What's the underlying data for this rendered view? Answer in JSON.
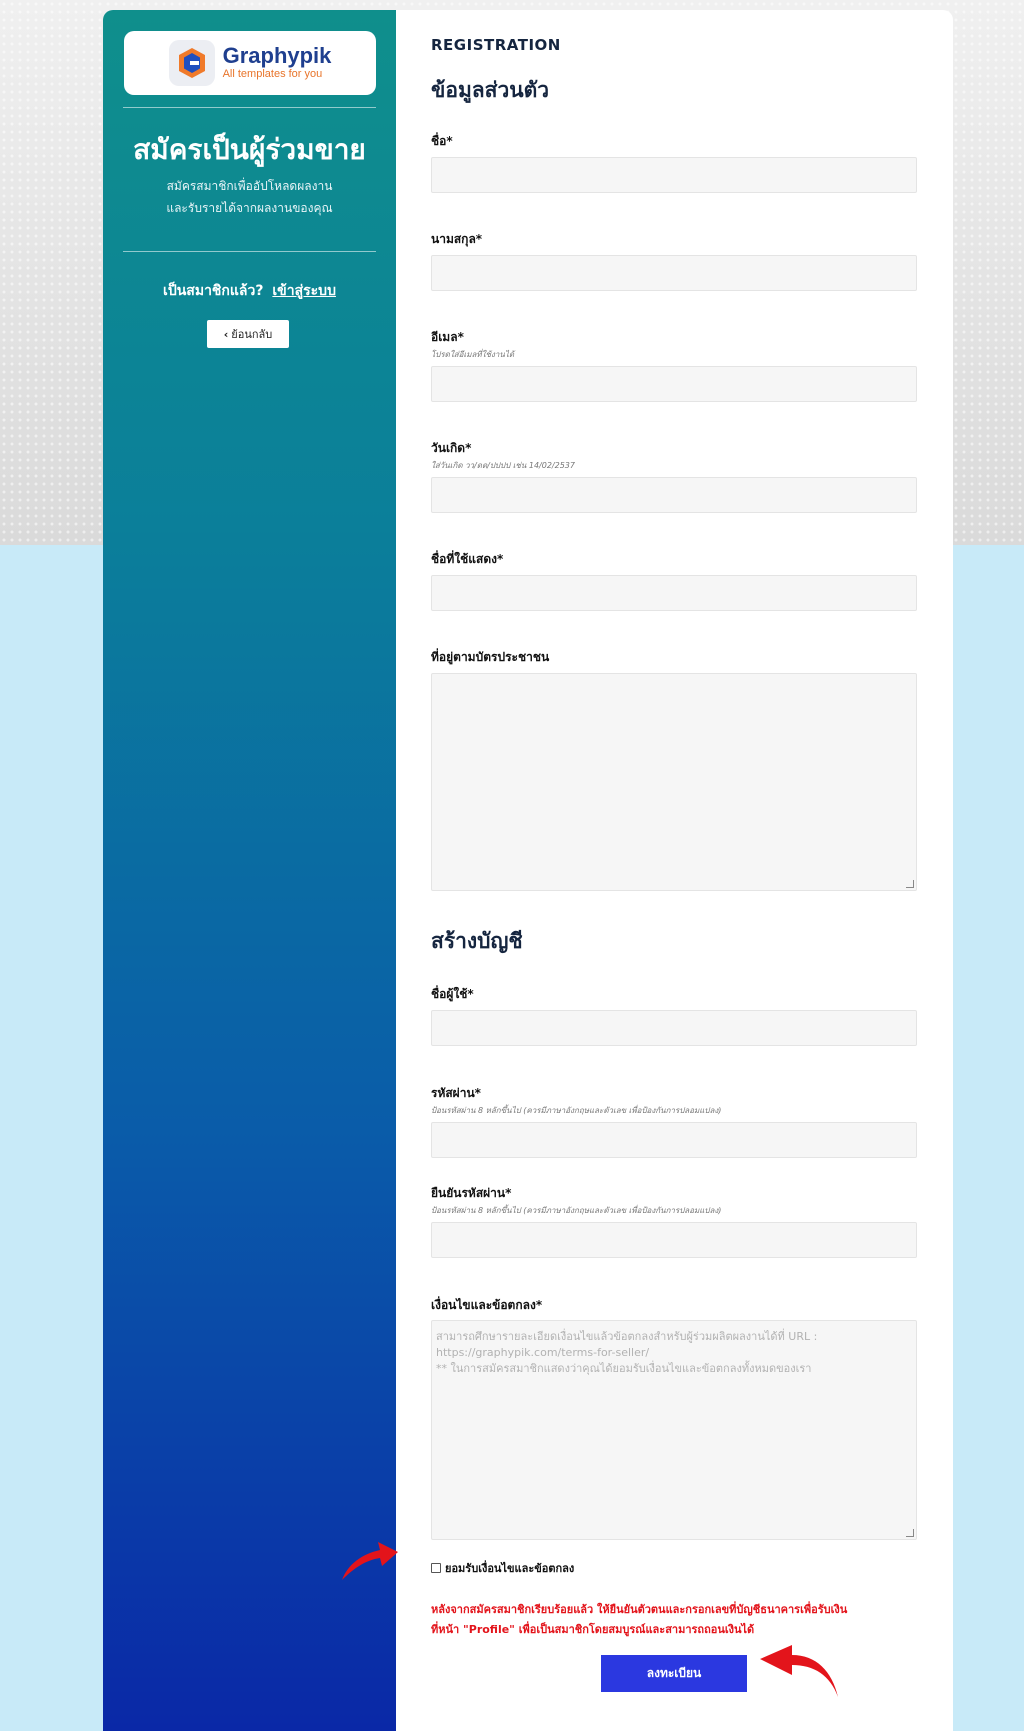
{
  "brand": {
    "name": "Graphypik",
    "tagline": "All templates for you"
  },
  "sidebar": {
    "title": "สมัครเป็นผู้ร่วมขาย",
    "desc_line1": "สมัครสมาชิกเพื่ออัปโหลดผลงาน",
    "desc_line2": "และรับรายได้จากผลงานของคุณ",
    "member_text": "เป็นสมาชิกแล้ว?",
    "login_link": "เข้าสู่ระบบ",
    "back_button": "ย้อนกลับ"
  },
  "form": {
    "eyebrow": "REGISTRATION",
    "section_personal": "ข้อมูลส่วนตัว",
    "first_name_label": "ชื่อ*",
    "last_name_label": "นามสกุล*",
    "email_label": "อีเมล*",
    "email_hint": "โปรดใส่อีเมลที่ใช้งานได้",
    "birthdate_label": "วันเกิด*",
    "birthdate_hint": "ใส่วันเกิด วว/ดด/ปปปป เช่น 14/02/2537",
    "display_name_label": "ชื่อที่ใช้แสดง*",
    "address_label": "ที่อยู่ตามบัตรประชาชน",
    "section_account": "สร้างบัญชี",
    "username_label": "ชื่อผู้ใช้*",
    "password_label": "รหัสผ่าน*",
    "password_hint": "ป้อนรหัสผ่าน 8 หลักขึ้นไป (ควรมีภาษาอังกฤษและตัวเลข เพื่อป้องกันการปลอมแปลง)",
    "confirm_password_label": "ยืนยันรหัสผ่าน*",
    "confirm_password_hint": "ป้อนรหัสผ่าน 8 หลักขึ้นไป (ควรมีภาษาอังกฤษและตัวเลข เพื่อป้องกันการปลอมแปลง)",
    "terms_label": "เงื่อนไขและข้อตกลง*",
    "terms_text": "สามารถศึกษารายละเอียดเงื่อนไขแล้วข้อตกลงสำหรับผู้ร่วมผลิตผลงานได้ที่ URL :\nhttps://graphypik.com/terms-for-seller/\n** ในการสมัครสมาชิกแสดงว่าคุณได้ยอมรับเงื่อนไขและข้อตกลงทั้งหมดของเรา",
    "accept_label": "ยอมรับเงื่อนไขและข้อตกลง",
    "notice_line1": "หลังจากสมัครสมาชิกเรียบร้อยแล้ว ให้ยืนยันตัวตนและกรอกเลขที่บัญชีธนาคารเพื่อรับเงิน",
    "notice_line2": "ที่หน้า \"Profile\" เพื่อเป็นสมาชิกโดยสมบูรณ์และสามารถถอนเงินได้",
    "submit_button": "ลงทะเบียน"
  },
  "colors": {
    "accent": "#2b38e0",
    "notice": "#e3141b",
    "arrow": "#e3141b"
  }
}
